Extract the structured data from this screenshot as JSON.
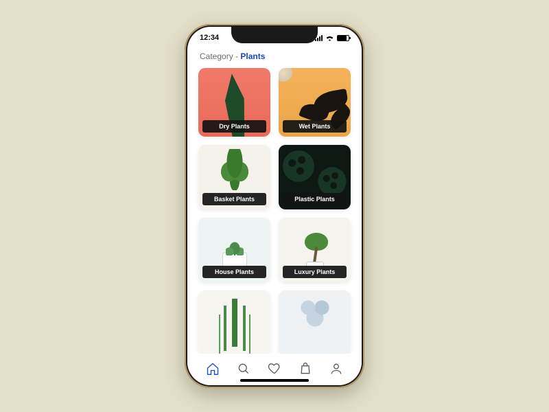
{
  "status": {
    "time": "12:34"
  },
  "header": {
    "label": "Category",
    "separator": " - ",
    "value": "Plants"
  },
  "cards": [
    {
      "label": "Dry Plants"
    },
    {
      "label": "Wet Plants"
    },
    {
      "label": "Basket Plants"
    },
    {
      "label": "Plastic Plants"
    },
    {
      "label": "House Plants"
    },
    {
      "label": "Luxury Plants"
    }
  ],
  "tabs": {
    "home": "Home",
    "search": "Search",
    "favorites": "Favorites",
    "bag": "Bag",
    "profile": "Profile"
  }
}
